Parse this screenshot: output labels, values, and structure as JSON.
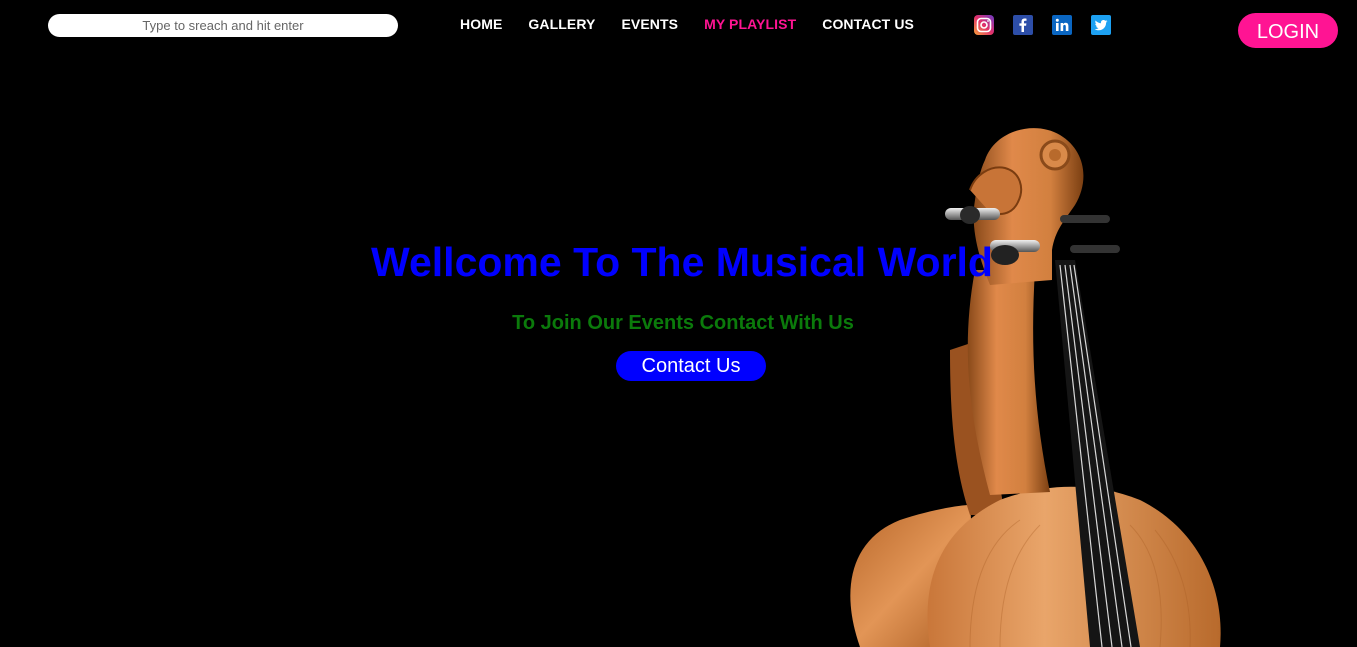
{
  "header": {
    "search": {
      "placeholder": "Type to sreach and hit enter"
    },
    "nav": [
      {
        "label": "HOME",
        "active": false
      },
      {
        "label": "GALLERY",
        "active": false
      },
      {
        "label": "EVENTS",
        "active": false
      },
      {
        "label": "MY PLAYLIST",
        "active": true
      },
      {
        "label": "CONTACT US",
        "active": false
      }
    ],
    "social": [
      {
        "icon": "instagram-icon"
      },
      {
        "icon": "facebook-icon"
      },
      {
        "icon": "linkedin-icon"
      },
      {
        "icon": "twitter-icon"
      }
    ],
    "login_label": "LOGIN"
  },
  "hero": {
    "title": "Wellcome To The Musical World",
    "subtitle": "To Join Our Events Contact With Us",
    "button_label": "Contact Us",
    "image": "violin"
  },
  "colors": {
    "background": "#000000",
    "accent": "#ff1493",
    "title": "#0000ff",
    "subtitle": "#0b7a0b",
    "button": "#0000ff",
    "nav_text": "#ffffff"
  }
}
